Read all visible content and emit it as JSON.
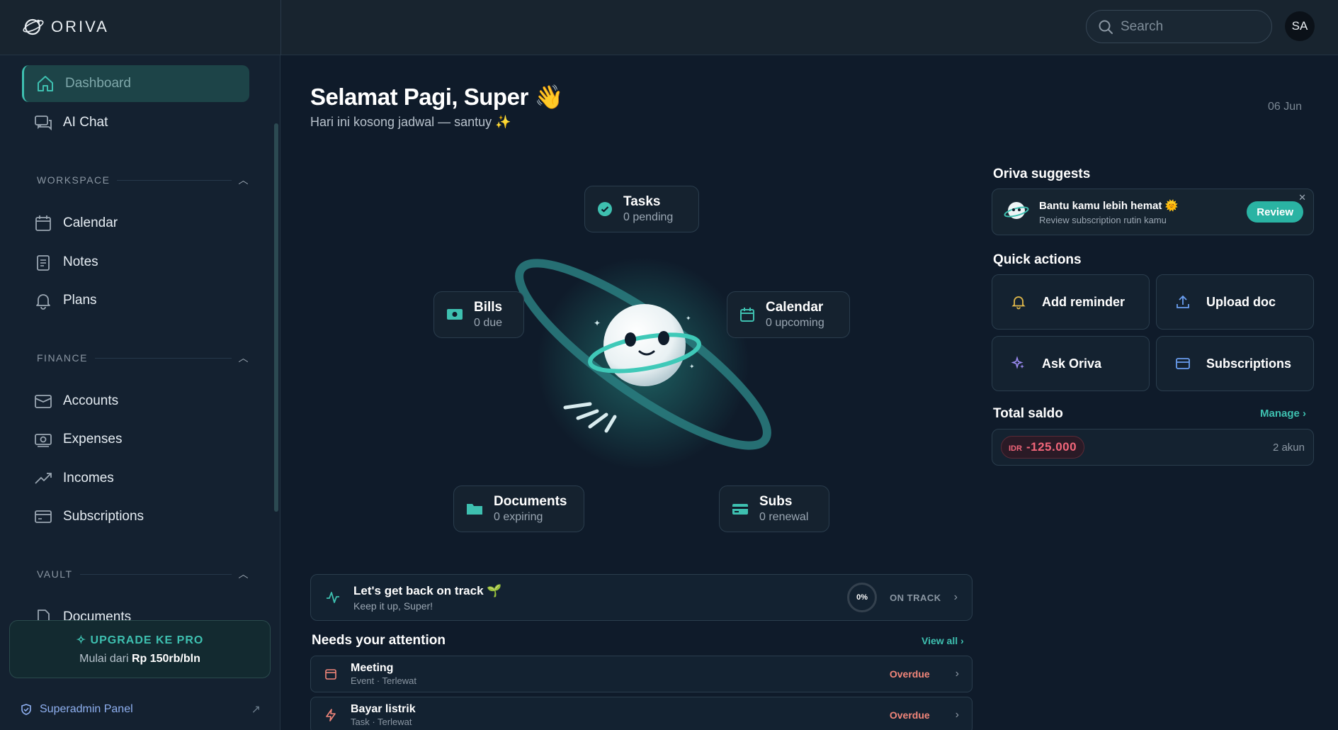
{
  "app": {
    "brand": "ORIVA",
    "accent": "#3ec0b0"
  },
  "topbar": {
    "search_placeholder": "Search",
    "avatar_initials": "SA"
  },
  "sidebar": {
    "primary": [
      {
        "label": "Dashboard",
        "icon": "home-icon",
        "active": true
      },
      {
        "label": "AI Chat",
        "icon": "chat-icon"
      }
    ],
    "sections": [
      {
        "title": "WORKSPACE",
        "items": [
          {
            "label": "Calendar",
            "icon": "calendar-icon"
          },
          {
            "label": "Notes",
            "icon": "notes-icon"
          },
          {
            "label": "Plans",
            "icon": "bell-icon"
          }
        ]
      },
      {
        "title": "FINANCE",
        "items": [
          {
            "label": "Accounts",
            "icon": "wallet-icon"
          },
          {
            "label": "Expenses",
            "icon": "money-icon"
          },
          {
            "label": "Incomes",
            "icon": "trend-up-icon"
          },
          {
            "label": "Subscriptions",
            "icon": "card-icon"
          }
        ]
      },
      {
        "title": "VAULT",
        "items": [
          {
            "label": "Documents",
            "icon": "document-icon"
          }
        ]
      }
    ],
    "upgrade": {
      "title": "UPGRADE KE PRO",
      "sub_prefix": "Mulai dari",
      "price": "Rp 150rb/bln"
    },
    "admin_label": "Superadmin Panel"
  },
  "main": {
    "greeting": "Selamat Pagi, Super",
    "greeting_emoji": "👋",
    "subtitle": "Hari ini kosong jadwal — santuy ✨",
    "date": "06 Jun",
    "widgets": {
      "tasks": {
        "title": "Tasks",
        "sub": "0 pending"
      },
      "bills": {
        "title": "Bills",
        "sub": "0 due"
      },
      "calendar": {
        "title": "Calendar",
        "sub": "0 upcoming"
      },
      "documents": {
        "title": "Documents",
        "sub": "0 expiring"
      },
      "subs": {
        "title": "Subs",
        "sub": "0 renewal"
      }
    },
    "track": {
      "title": "Let's get back on track 🌱",
      "sub": "Keep it up, Super!",
      "percent": "0%",
      "status": "ON TRACK"
    },
    "attention": {
      "title": "Needs your attention",
      "view_all": "View all",
      "items": [
        {
          "title": "Meeting",
          "sub": "Event · Terlewat",
          "status": "Overdue",
          "icon": "calendar-icon"
        },
        {
          "title": "Bayar listrik",
          "sub": "Task · Terlewat",
          "status": "Overdue",
          "icon": "bolt-icon"
        }
      ]
    }
  },
  "right": {
    "suggest_title": "Oriva suggests",
    "suggest": {
      "title": "Bantu kamu lebih hemat 🌞",
      "sub": "Review subscription rutin kamu",
      "button": "Review"
    },
    "quick_title": "Quick actions",
    "quick": [
      {
        "label": "Add reminder",
        "icon": "bell-icon"
      },
      {
        "label": "Upload doc",
        "icon": "upload-icon"
      },
      {
        "label": "Ask Oriva",
        "icon": "sparkle-icon"
      },
      {
        "label": "Subscriptions",
        "icon": "card-icon"
      }
    ],
    "saldo_title": "Total saldo",
    "manage": "Manage",
    "saldo": {
      "currency": "IDR",
      "amount": "-125.000",
      "accounts": "2 akun"
    }
  }
}
